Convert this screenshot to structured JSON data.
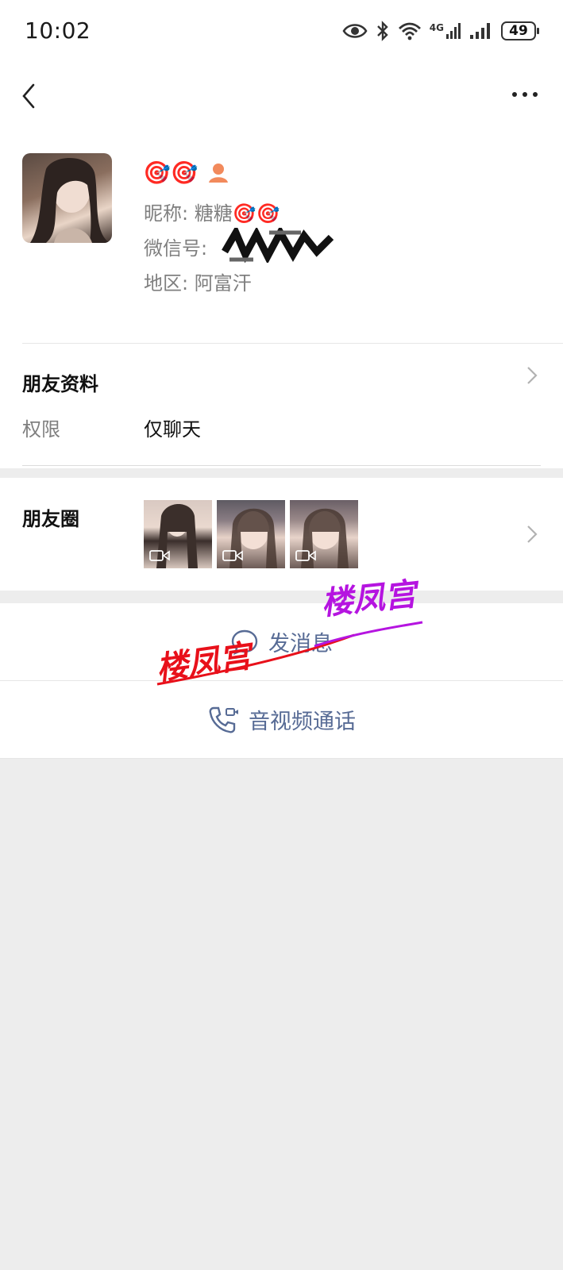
{
  "status_bar": {
    "time": "10:02",
    "battery": "49",
    "network": "4G",
    "icons": [
      "eye-icon",
      "bluetooth-icon",
      "wifi-icon",
      "signal-icon",
      "battery-icon"
    ]
  },
  "nav": {
    "back_icon": "chevron-left-icon",
    "more_icon": "more-dots-icon"
  },
  "profile": {
    "display_name_emojis": "🎯🎯",
    "nickname_label": "昵称:",
    "nickname_value": "糖糖🎯🎯",
    "wechat_id_label": "微信号:",
    "wechat_id_value": "",
    "region_label": "地区:",
    "region_value": "阿富汗"
  },
  "friend_info": {
    "title": "朋友资料",
    "permission_label": "权限",
    "permission_value": "仅聊天"
  },
  "moments": {
    "title": "朋友圈",
    "thumb_count": 3
  },
  "actions": {
    "send_message": "发消息",
    "video_call": "音视频通话"
  },
  "watermark": {
    "text_1": "楼凤宫",
    "text_2": "楼凤宫",
    "color_1": "#e8101a",
    "color_2": "#b514e0"
  },
  "colors": {
    "link": "#576b95",
    "background": "#ededed"
  }
}
